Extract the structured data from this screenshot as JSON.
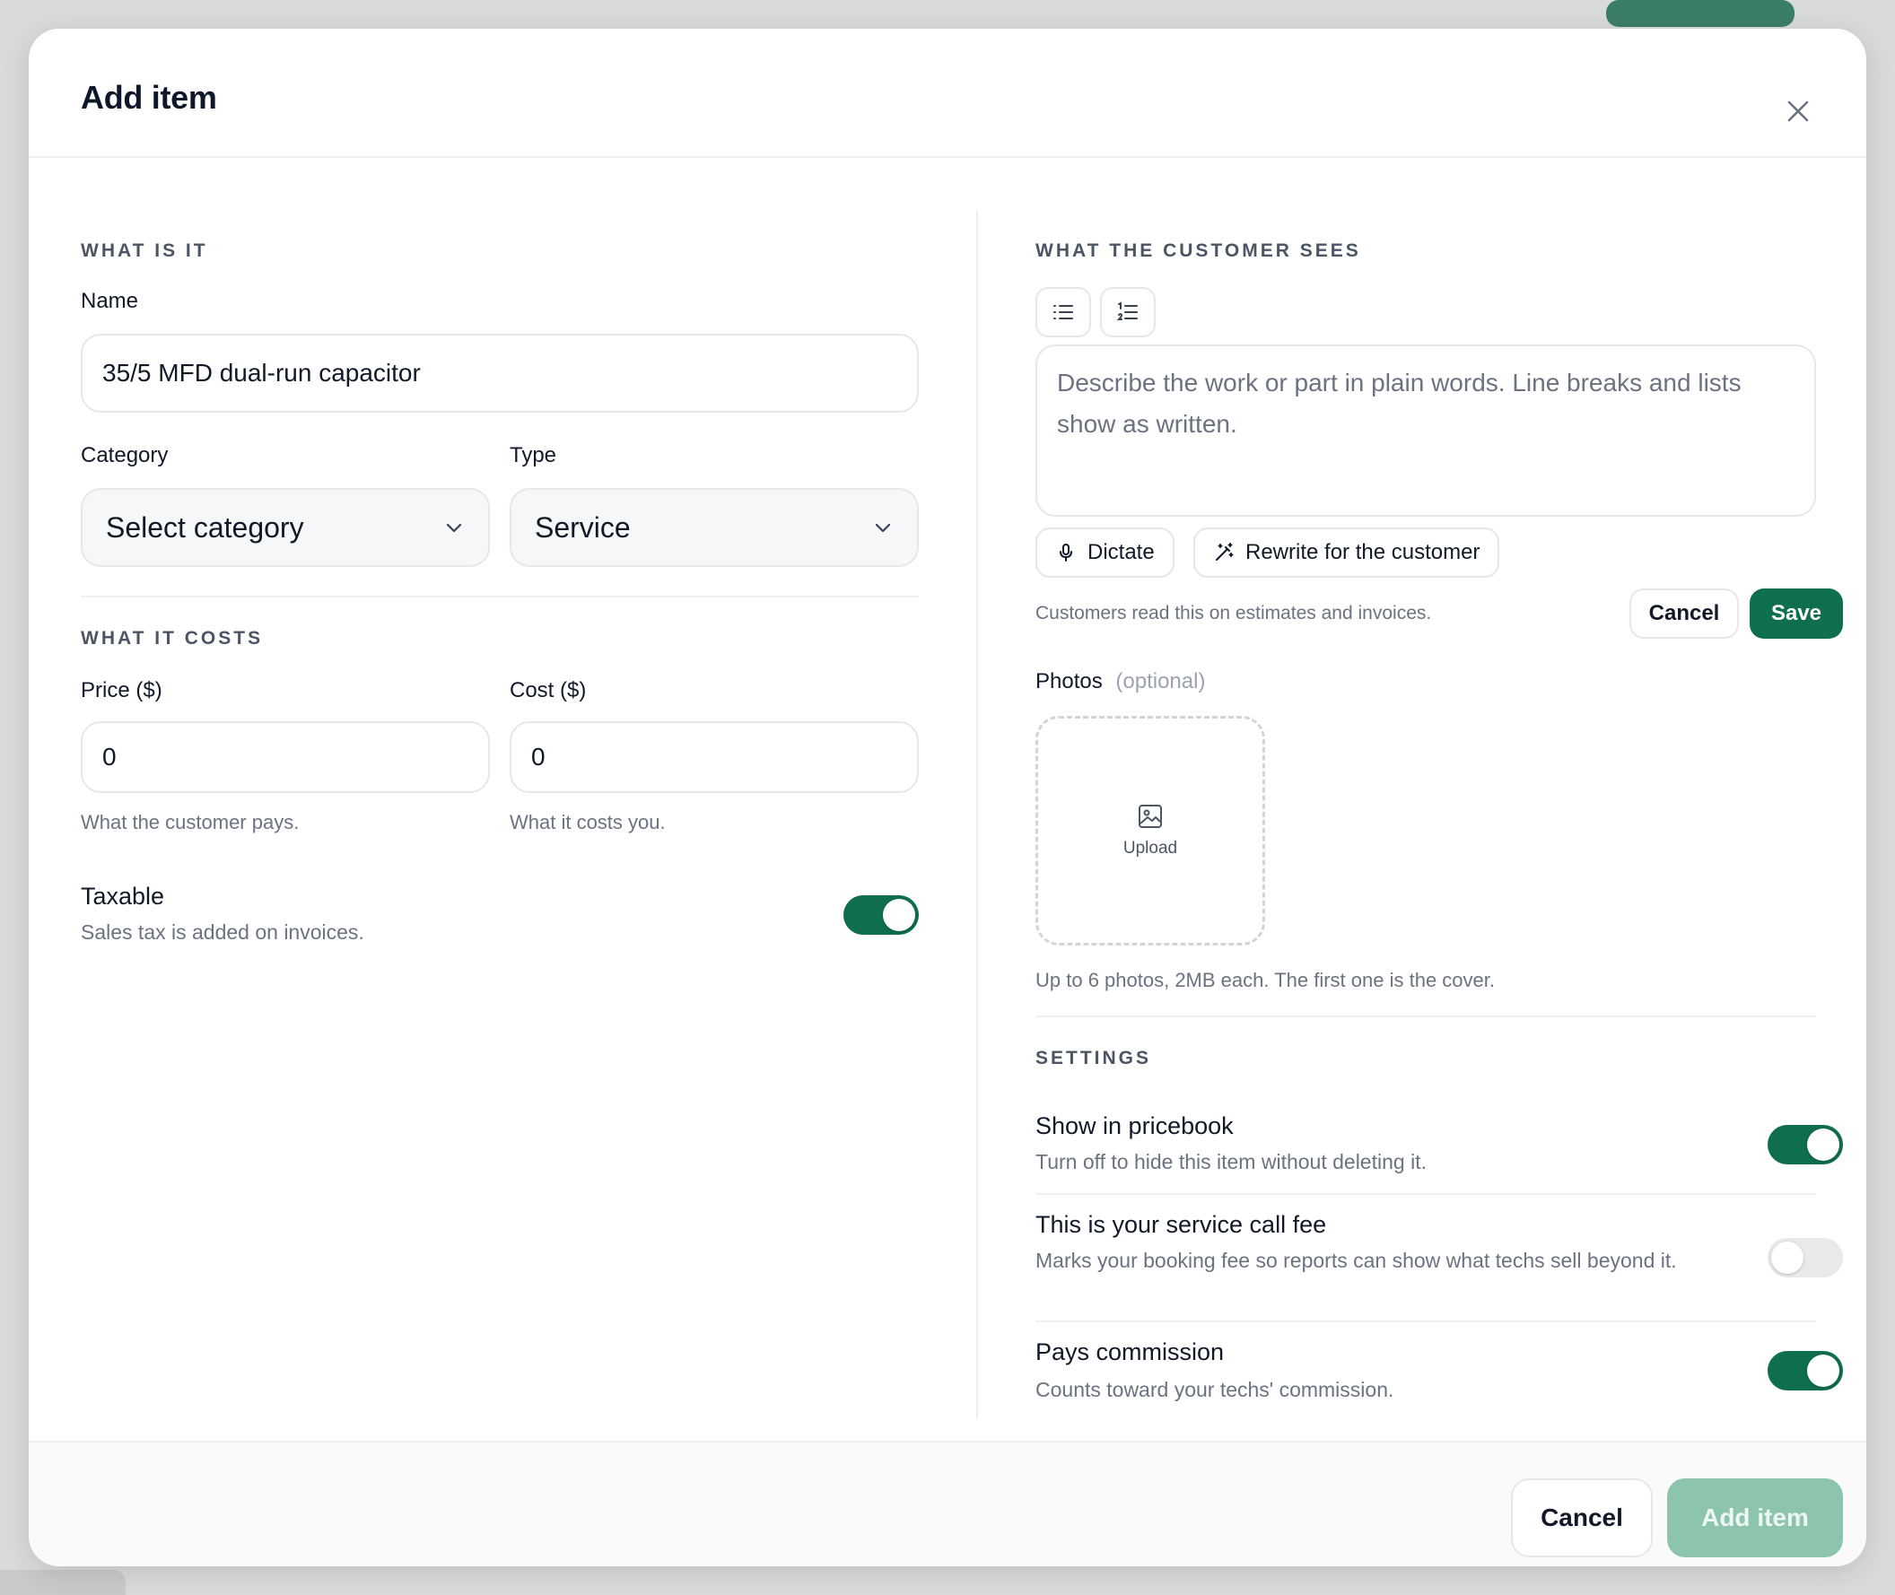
{
  "modal": {
    "title": "Add item",
    "close_label": "×"
  },
  "left": {
    "section_what": "WHAT IS IT",
    "name_label": "Name",
    "name_value": "35/5 MFD dual-run capacitor",
    "category_label": "Category",
    "category_value": "Select category",
    "type_label": "Type",
    "type_value": "Service",
    "section_costs": "WHAT IT COSTS",
    "price_label": "Price ($)",
    "price_value": "0",
    "price_hint": "What the customer pays.",
    "cost_label": "Cost ($)",
    "cost_value": "0",
    "cost_hint": "What it costs you.",
    "taxable_title": "Taxable",
    "taxable_desc": "Sales tax is added on invoices.",
    "taxable_on": true
  },
  "right": {
    "section_customer": "WHAT THE CUSTOMER SEES",
    "description_placeholder": "Describe the work or part in plain words. Line breaks and lists show as written.",
    "dictate_label": "Dictate",
    "rewrite_label": "Rewrite for the customer",
    "description_hint": "Customers read this on estimates and invoices.",
    "cancel_label": "Cancel",
    "save_label": "Save",
    "photos_label": "Photos",
    "photos_optional": "(optional)",
    "upload_label": "Upload",
    "photos_hint": "Up to 6 photos, 2MB each. The first one is the cover.",
    "section_settings": "SETTINGS",
    "settings": [
      {
        "title": "Show in pricebook",
        "desc": "Turn off to hide this item without deleting it.",
        "on": true
      },
      {
        "title": "This is your service call fee",
        "desc": "Marks your booking fee so reports can show what techs sell beyond it.",
        "on": false
      },
      {
        "title": "Pays commission",
        "desc": "Counts toward your techs' commission.",
        "on": true
      }
    ]
  },
  "footer": {
    "cancel_label": "Cancel",
    "add_label": "Add item"
  },
  "colors": {
    "accent": "#0f6e4e",
    "accent_disabled": "#8cc4ad"
  }
}
